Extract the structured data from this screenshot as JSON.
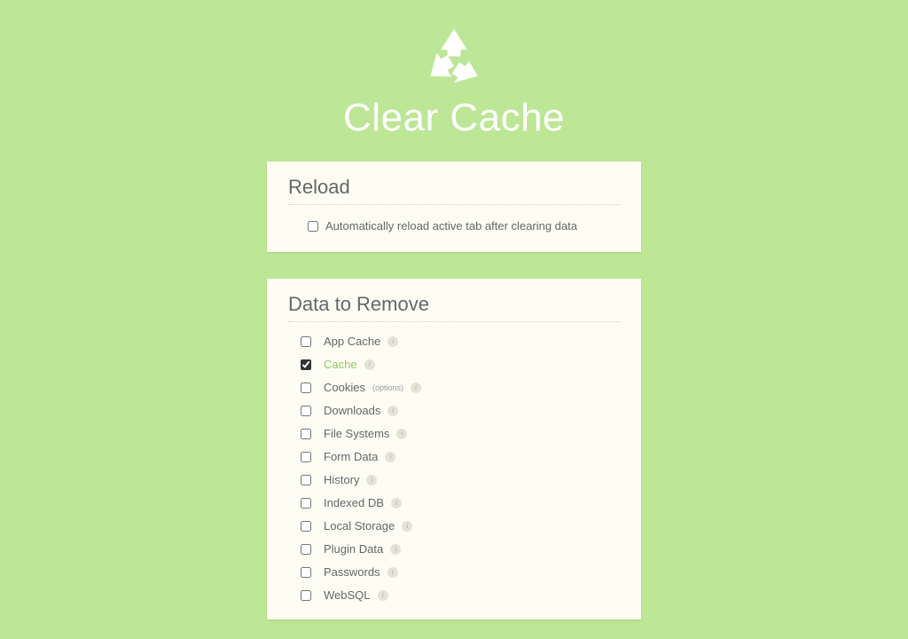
{
  "app": {
    "title": "Clear Cache"
  },
  "reload": {
    "heading": "Reload",
    "auto_reload_label": "Automatically reload active tab after clearing data",
    "auto_reload_checked": false
  },
  "data_to_remove": {
    "heading": "Data to Remove",
    "options_link_label": "(options)",
    "items": [
      {
        "label": "App Cache",
        "checked": false,
        "has_info": true,
        "has_options": false
      },
      {
        "label": "Cache",
        "checked": true,
        "has_info": true,
        "has_options": false
      },
      {
        "label": "Cookies",
        "checked": false,
        "has_info": false,
        "has_options": true
      },
      {
        "label": "Downloads",
        "checked": false,
        "has_info": true,
        "has_options": false
      },
      {
        "label": "File Systems",
        "checked": false,
        "has_info": true,
        "has_options": false
      },
      {
        "label": "Form Data",
        "checked": false,
        "has_info": true,
        "has_options": false
      },
      {
        "label": "History",
        "checked": false,
        "has_info": true,
        "has_options": false
      },
      {
        "label": "Indexed DB",
        "checked": false,
        "has_info": true,
        "has_options": false
      },
      {
        "label": "Local Storage",
        "checked": false,
        "has_info": true,
        "has_options": false
      },
      {
        "label": "Plugin Data",
        "checked": false,
        "has_info": true,
        "has_options": false
      },
      {
        "label": "Passwords",
        "checked": false,
        "has_info": true,
        "has_options": false
      },
      {
        "label": "WebSQL",
        "checked": false,
        "has_info": true,
        "has_options": false
      }
    ]
  }
}
